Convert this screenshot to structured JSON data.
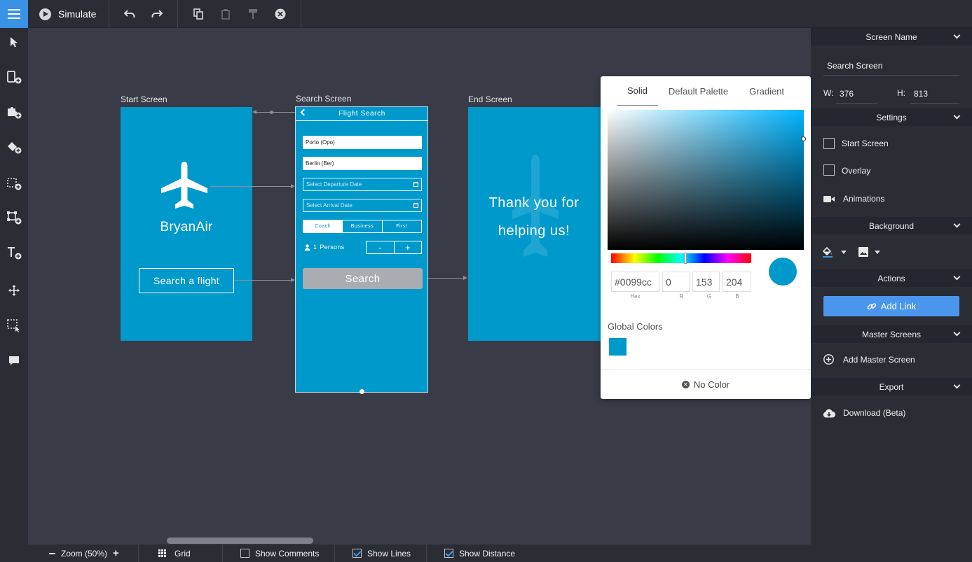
{
  "toolbar": {
    "simulate_label": "Simulate"
  },
  "canvas": {
    "start_screen": {
      "label": "Start Screen",
      "brand": "BryanAir",
      "button": "Search a flight"
    },
    "search_screen": {
      "label": "Search Screen",
      "header": "Flight Search",
      "from_value": "Porto (Opo)",
      "to_value": "Berlin (Ber)",
      "departure_placeholder": "Select Departure Date",
      "arrival_placeholder": "Select Arrival Date",
      "classes": [
        "Coach",
        "Business",
        "First"
      ],
      "persons_count": "1",
      "persons_label": "Persons",
      "minus": "-",
      "plus": "+",
      "search_button": "Search"
    },
    "end_screen": {
      "label": "End Screen",
      "line1": "Thank you for",
      "line2": "helping us!"
    },
    "screen_color": "#0099cc"
  },
  "color_picker": {
    "tabs": [
      "Solid",
      "Default Palette",
      "Gradient"
    ],
    "active_tab": "Solid",
    "hex": "#0099cc",
    "r": "0",
    "g": "153",
    "b": "204",
    "labels": {
      "hex": "Hex",
      "r": "R",
      "g": "G",
      "b": "B"
    },
    "global_colors_title": "Global Colors",
    "global_colors": [
      "#0099cc"
    ],
    "no_color_label": "No Color"
  },
  "right_panel": {
    "screen_name_header": "Screen Name",
    "screen_name_value": "Search Screen",
    "w_label": "W:",
    "w_value": "376",
    "h_label": "H:",
    "h_value": "813",
    "settings_header": "Settings",
    "start_screen_label": "Start Screen",
    "overlay_label": "Overlay",
    "animations_label": "Animations",
    "background_header": "Background",
    "actions_header": "Actions",
    "add_link_label": "Add Link",
    "master_screens_header": "Master Screens",
    "add_master_label": "Add Master Screen",
    "export_header": "Export",
    "download_label": "Download (Beta)"
  },
  "bottom_bar": {
    "zoom_label": "Zoom (50%)",
    "grid_label": "Grid",
    "show_comments_label": "Show Comments",
    "show_comments": false,
    "show_lines_label": "Show Lines",
    "show_lines": true,
    "show_distance_label": "Show Distance",
    "show_distance": true
  }
}
